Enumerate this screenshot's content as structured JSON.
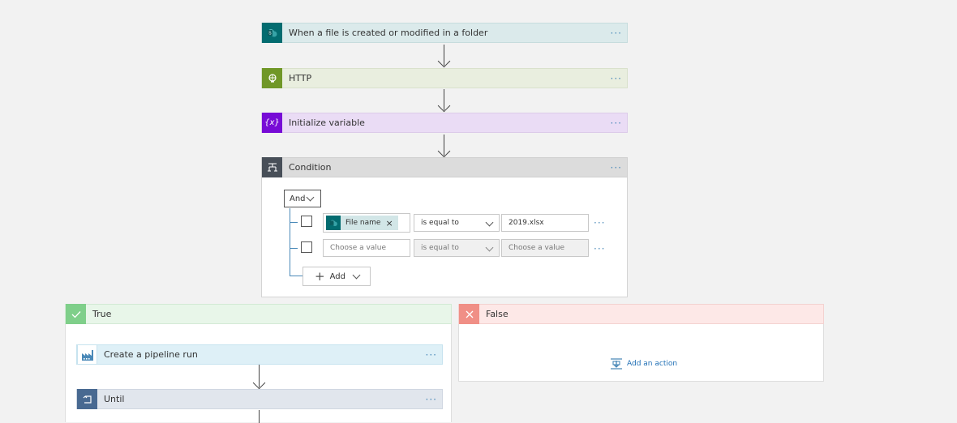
{
  "steps": {
    "trigger": {
      "title": "When a file is created or modified in a folder",
      "more": "···"
    },
    "http": {
      "title": "HTTP",
      "more": "···"
    },
    "init_var": {
      "title": "Initialize variable",
      "icon_text": "{x}",
      "more": "···"
    },
    "condition": {
      "title": "Condition",
      "more": "···"
    }
  },
  "condition_body": {
    "group_operator": "And",
    "rows": [
      {
        "token": "File name",
        "token_remove": "×",
        "operator": "is equal to",
        "value": "2019.xlsx",
        "more": "···"
      },
      {
        "left_placeholder": "Choose a value",
        "operator": "is equal to",
        "right_placeholder": "Choose a value",
        "more": "···"
      }
    ],
    "add_label": "Add"
  },
  "branches": {
    "true": {
      "label": "True",
      "actions": [
        {
          "title": "Create a pipeline run",
          "more": "···"
        },
        {
          "title": "Until",
          "more": "···"
        }
      ]
    },
    "false": {
      "label": "False",
      "add_action": "Add an action"
    }
  },
  "colors": {
    "sharepoint": "#036c70",
    "http": "#709727",
    "variable": "#770bd6",
    "condition": "#484f58",
    "true": "#7fcf8a",
    "false": "#f08f86",
    "link": "#4a89b8"
  }
}
